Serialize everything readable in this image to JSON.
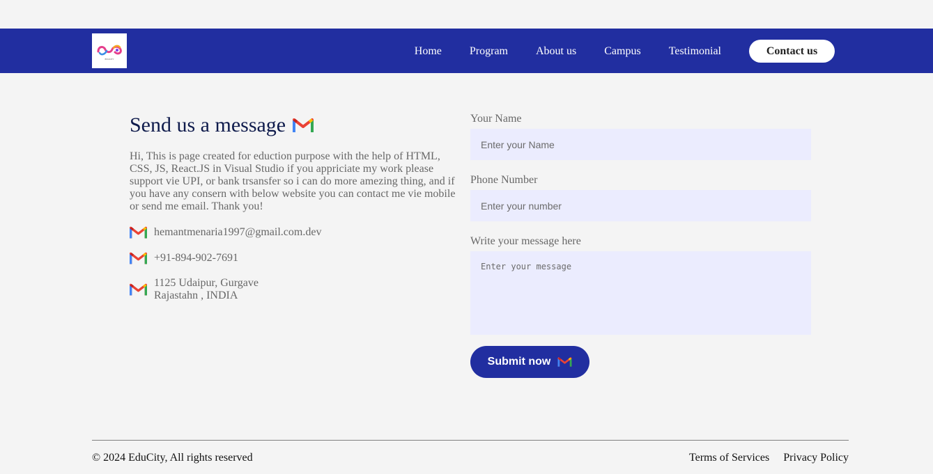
{
  "nav": {
    "logo_caption": "EDUCITY",
    "items": [
      {
        "label": "Home"
      },
      {
        "label": "Program"
      },
      {
        "label": "About us"
      },
      {
        "label": "Campus"
      },
      {
        "label": "Testimonial"
      }
    ],
    "contact_label": "Contact us"
  },
  "contact": {
    "heading": "Send us a message",
    "intro": "Hi, This is page created for eduction purpose with the help of HTML, CSS, JS, React.JS in Visual Studio if you appriciate my work please support vie UPI, or bank trsansfer so i can do more amezing thing, and if you have any consern with below website you can contact me vie mobile or send me email. Thank you!",
    "email": "hemantmenaria1997@gmail.com.dev",
    "phone": "+91-894-902-7691",
    "address_line1": "1125 Udaipur, Gurgave",
    "address_line2": "Rajastahn , INDIA",
    "icon": "gmail-icon"
  },
  "form": {
    "name_label": "Your Name",
    "name_placeholder": "Enter your Name",
    "name_value": "",
    "phone_label": "Phone Number",
    "phone_placeholder": "Enter your number",
    "phone_value": "",
    "message_label": "Write your message here",
    "message_placeholder": "Enter your message",
    "message_value": "",
    "submit_label": "Submit now"
  },
  "footer": {
    "copyright": "© 2024 EduCity, All rights reserved",
    "terms": "Terms of Services",
    "privacy": "Privacy Policy"
  },
  "colors": {
    "nav_bg": "#212ea0",
    "page_bg": "#f4f4f4",
    "input_bg": "#ebecfe",
    "heading": "#0f1b4c"
  }
}
